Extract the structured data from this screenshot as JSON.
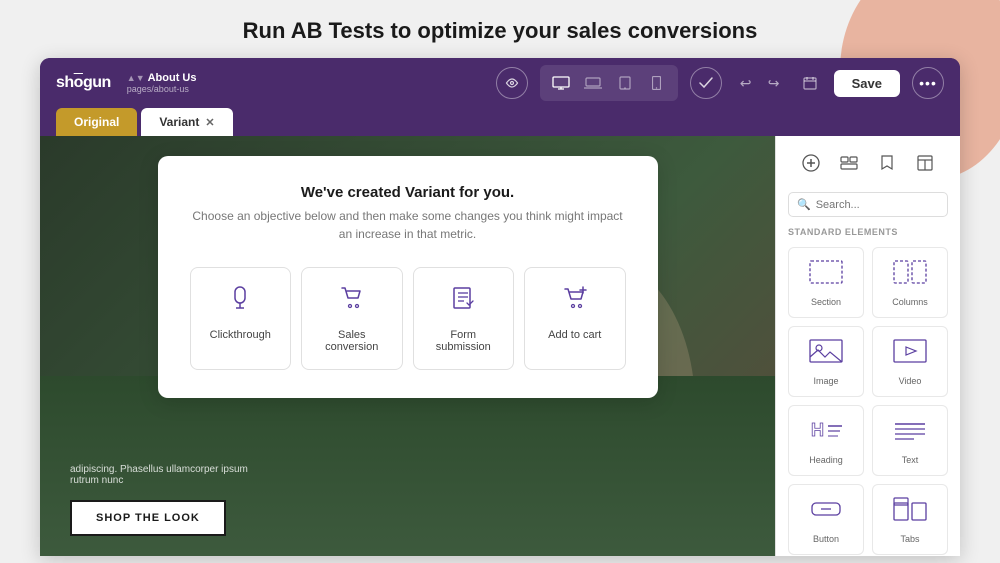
{
  "page": {
    "main_heading": "Run AB Tests to optimize your sales conversions"
  },
  "app": {
    "logo": "shōgun",
    "page_name": "About Us",
    "page_slug": "pages/about-us"
  },
  "toolbar": {
    "save_label": "Save",
    "more_label": "···"
  },
  "tabs": [
    {
      "id": "original",
      "label": "Original",
      "active": false
    },
    {
      "id": "variant",
      "label": "Variant",
      "active": true,
      "closable": true
    }
  ],
  "modal": {
    "title": "We've created Variant for you.",
    "subtitle": "Choose an objective below and then make some changes you\nthink might impact an increase in that metric.",
    "objectives": [
      {
        "id": "clickthrough",
        "label": "Clickthrough",
        "icon": "mouse"
      },
      {
        "id": "sales-conversion",
        "label": "Sales conversion",
        "icon": "bag"
      },
      {
        "id": "form-submission",
        "label": "Form submission",
        "icon": "form"
      },
      {
        "id": "add-to-cart",
        "label": "Add to cart",
        "icon": "cart"
      }
    ]
  },
  "canvas": {
    "bg_text": "adipiscing. Phasellus ullamcorper ipsum rutrum nunc",
    "shop_button_label": "SHOP THE LOOK"
  },
  "sidebar": {
    "search_placeholder": "Search...",
    "standard_elements_label": "STANDARD ELEMENTS",
    "elements": [
      {
        "id": "section",
        "label": "Section"
      },
      {
        "id": "columns",
        "label": "Columns"
      },
      {
        "id": "image",
        "label": "Image"
      },
      {
        "id": "video",
        "label": "Video"
      },
      {
        "id": "heading",
        "label": "Heading"
      },
      {
        "id": "text",
        "label": "Text"
      },
      {
        "id": "button",
        "label": "Button"
      },
      {
        "id": "tabs",
        "label": "Tabs"
      }
    ]
  },
  "colors": {
    "purple_dark": "#4a2b6b",
    "gold": "#c49a2a",
    "accent_purple": "#5b3fa0",
    "bg_decoration": "#e8b4a0"
  }
}
